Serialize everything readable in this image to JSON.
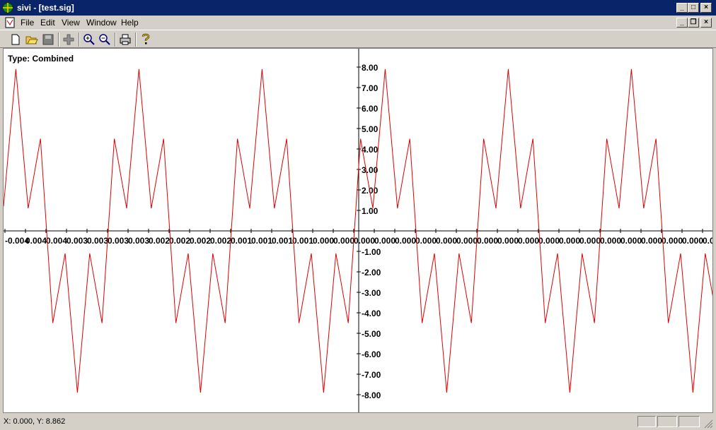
{
  "window": {
    "title": "sivi - [test.sig]"
  },
  "menu": [
    "File",
    "Edit",
    "View",
    "Window",
    "Help"
  ],
  "toolbar_icons": [
    "new-icon",
    "open-icon",
    "save-icon",
    "add-icon",
    "zoom-in-icon",
    "zoom-out-icon",
    "print-icon",
    "help-icon"
  ],
  "plot": {
    "type_label": "Type: Combined"
  },
  "status": {
    "coords": "X: 0.000, Y: 8.862"
  },
  "chart_data": {
    "type": "line",
    "series_color": "#dd0000",
    "y_ticks": [
      "8.00",
      "7.00",
      "6.00",
      "5.00",
      "4.00",
      "3.00",
      "2.00",
      "1.00",
      "-1.00",
      "-2.00",
      "-3.00",
      "-4.00",
      "-5.00",
      "-6.00",
      "-7.00",
      "-8.00"
    ],
    "x_tick_labels": [
      "-0.004",
      "0.004",
      "0.004",
      "0.003",
      "0.003",
      "0.003",
      "0.003",
      "0.002",
      "0.002",
      "0.002",
      "0.002",
      "0.001",
      "0.001",
      "0.001",
      "0.001",
      "0.000",
      "0.000",
      "0.000",
      "0.000",
      "0.000",
      "0.000",
      "0.000",
      "0.000",
      "0.000",
      "0.000",
      "0.000",
      "0.000",
      "0.000",
      "0.000",
      "0.000",
      "0.000",
      "0.000",
      "0.000",
      "0.000",
      "0.000",
      "0.000",
      "0.000",
      "0.000"
    ],
    "ylim": [
      -9.0,
      9.0
    ],
    "signal_samples": [
      1.2,
      7.9,
      1.1,
      4.5,
      -4.5,
      -1.1,
      -7.9,
      -1.1,
      -4.5,
      4.5,
      1.1,
      7.9,
      1.1,
      4.5,
      -4.5,
      -1.1,
      -7.9,
      -1.1,
      -4.5,
      4.5,
      1.1,
      7.9,
      1.1,
      4.5,
      -4.5,
      -1.1,
      -7.9,
      -1.1,
      -4.5,
      4.5,
      1.1,
      7.9,
      1.1,
      4.5,
      -4.5,
      -1.1,
      -7.9,
      -1.1,
      -4.5,
      4.5,
      1.1,
      7.9,
      1.1,
      4.5,
      -4.5,
      -1.1,
      -7.9,
      -1.1,
      -4.5,
      4.5,
      1.1,
      7.9,
      1.1,
      4.5,
      -4.5,
      -1.1,
      -7.9,
      -1.1,
      -4.5,
      4.5,
      1.1,
      7.9,
      1.1,
      4.5,
      -4.5,
      -1.1,
      -7.9,
      -1.1,
      -4.5,
      4.5,
      1.1,
      7.9,
      1.1,
      4.5,
      -4.5,
      -1.1,
      -7.9,
      -1.1,
      -4.5,
      4.5,
      1.1,
      7.9,
      1.1,
      4.5,
      -4.5,
      -1.1,
      -7.9,
      -1.1,
      -4.5,
      4.5,
      1.1,
      7.9,
      1.1,
      4.5,
      -4.5,
      -1.1,
      -7.9,
      -1.1,
      -4.5,
      4.5
    ]
  }
}
